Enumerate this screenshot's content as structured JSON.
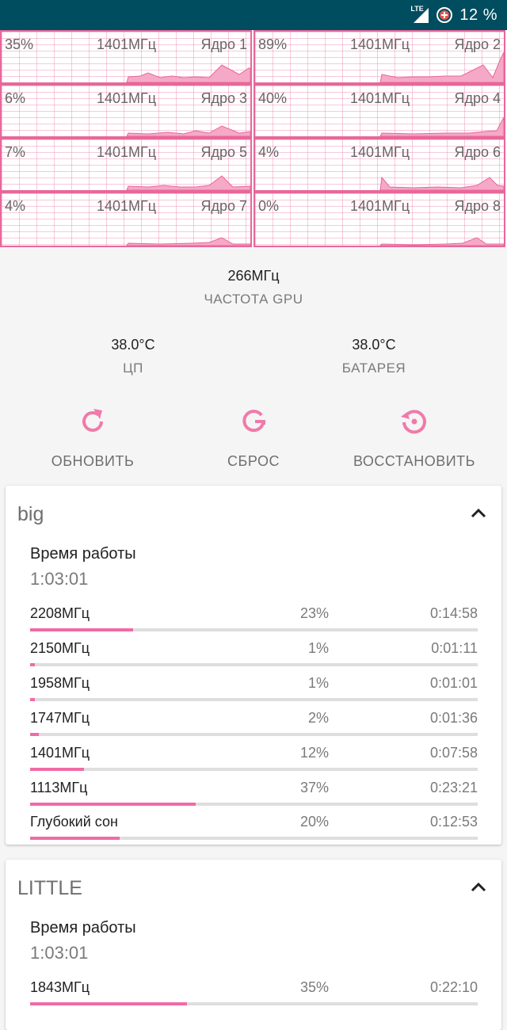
{
  "status": {
    "battery": "12 %",
    "network": "LTE"
  },
  "cores": [
    {
      "pct": "35%",
      "freq": "1401МГц",
      "name": "Ядро 1"
    },
    {
      "pct": "89%",
      "freq": "1401МГц",
      "name": "Ядро 2"
    },
    {
      "pct": "6%",
      "freq": "1401МГц",
      "name": "Ядро 3"
    },
    {
      "pct": "40%",
      "freq": "1401МГц",
      "name": "Ядро 4"
    },
    {
      "pct": "7%",
      "freq": "1401МГц",
      "name": "Ядро 5"
    },
    {
      "pct": "4%",
      "freq": "1401МГц",
      "name": "Ядро 6"
    },
    {
      "pct": "4%",
      "freq": "1401МГц",
      "name": "Ядро 7"
    },
    {
      "pct": "0%",
      "freq": "1401МГц",
      "name": "Ядро 8"
    }
  ],
  "gpu": {
    "value": "266МГц",
    "label": "ЧАСТОТА GPU"
  },
  "cpu_temp": {
    "value": "38.0°C",
    "label": "ЦП"
  },
  "battery_temp": {
    "value": "38.0°C",
    "label": "БАТАРЕЯ"
  },
  "actions": {
    "refresh": "ОБНОВИТЬ",
    "reset": "СБРОС",
    "restore": "ВОССТАНОВИТЬ"
  },
  "big": {
    "title": "big",
    "uptime_label": "Время работы",
    "uptime": "1:03:01",
    "rows": [
      {
        "freq": "2208МГц",
        "pct": "23%",
        "time": "0:14:58",
        "fill": 0.23
      },
      {
        "freq": "2150МГц",
        "pct": "1%",
        "time": "0:01:11",
        "fill": 0.01
      },
      {
        "freq": "1958МГц",
        "pct": "1%",
        "time": "0:01:01",
        "fill": 0.01
      },
      {
        "freq": "1747МГц",
        "pct": "2%",
        "time": "0:01:36",
        "fill": 0.02
      },
      {
        "freq": "1401МГц",
        "pct": "12%",
        "time": "0:07:58",
        "fill": 0.12
      },
      {
        "freq": "1113МГц",
        "pct": "37%",
        "time": "0:23:21",
        "fill": 0.37
      },
      {
        "freq": "Глубокий сон",
        "pct": "20%",
        "time": "0:12:53",
        "fill": 0.2
      }
    ]
  },
  "little": {
    "title": "LITTLE",
    "uptime_label": "Время работы",
    "uptime": "1:03:01",
    "rows": [
      {
        "freq": "1843МГц",
        "pct": "35%",
        "time": "0:22:10",
        "fill": 0.35
      }
    ]
  }
}
